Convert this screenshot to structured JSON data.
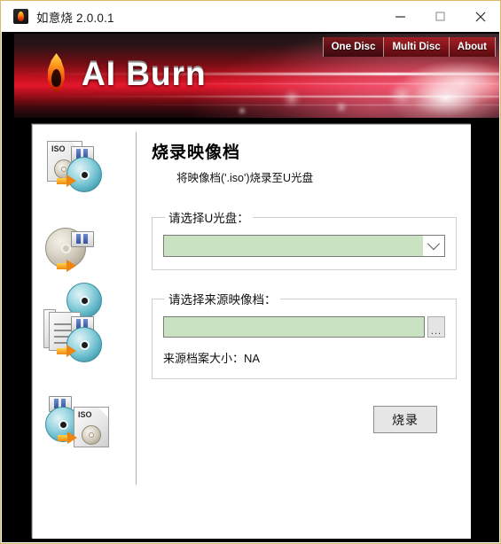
{
  "titlebar": {
    "app_icon": "flame-icon",
    "title": "如意烧 2.0.0.1",
    "minimize_label": "—",
    "maximize_label": "□",
    "close_label": "✕"
  },
  "banner": {
    "logo_text": "AI Burn",
    "logo_icon": "flame-logo-icon",
    "accent_color": "#c1111e"
  },
  "nav": {
    "tabs": [
      {
        "label": "One Disc",
        "active": true
      },
      {
        "label": "Multi Disc",
        "active": false
      },
      {
        "label": "About",
        "active": false
      }
    ]
  },
  "sidebar": {
    "items": [
      {
        "name": "iso-to-usb",
        "icon": "iso-file-to-usb-disc-icon"
      },
      {
        "name": "disc-to-usb",
        "icon": "disc-to-usb-disc-icon"
      },
      {
        "name": "files-to-usb",
        "icon": "documents-to-usb-disc-icon"
      },
      {
        "name": "usb-to-iso",
        "icon": "usb-disc-to-iso-file-icon"
      }
    ]
  },
  "main": {
    "heading": "烧录映像档",
    "subheading": "将映像档('.iso')烧录至U光盘",
    "usb_group": {
      "legend": "请选择U光盘：",
      "combo_value": "",
      "combo_placeholder": "",
      "dropdown_icon": "chevron-down-icon",
      "field_color": "#c9e3c2"
    },
    "source_group": {
      "legend": "请选择来源映像档：",
      "path_value": "",
      "path_placeholder": "",
      "browse_label": "...",
      "filesize_label": "来源档案大小：",
      "filesize_value": "NA",
      "filesize_text": "来源档案大小：NA"
    },
    "burn_button": "烧录"
  }
}
